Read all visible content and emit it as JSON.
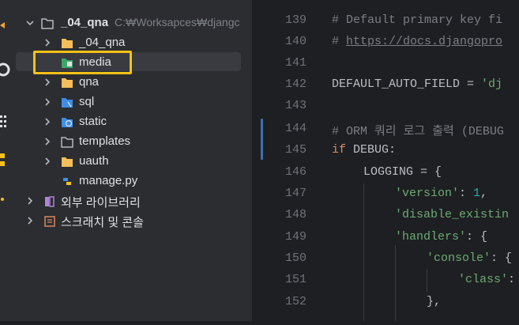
{
  "colors": {
    "highlight": "#f7c118",
    "keyword": "#cf8e6d",
    "string": "#6aab73",
    "number": "#2aacb8",
    "comment": "#7a7e85"
  },
  "tree": {
    "root": {
      "name": "_04_qna",
      "path": "C:₩Worksapces₩djangc",
      "icon": "folder-icon"
    },
    "items": [
      {
        "label": "_04_qna",
        "icon": "folder-icon"
      },
      {
        "label": "media",
        "icon": "resource-folder-icon"
      },
      {
        "label": "qna",
        "icon": "folder-icon"
      },
      {
        "label": "sql",
        "icon": "sql-folder-icon"
      },
      {
        "label": "static",
        "icon": "web-folder-icon"
      },
      {
        "label": "templates",
        "icon": "folder-outline-icon"
      },
      {
        "label": "uauth",
        "icon": "folder-icon"
      },
      {
        "label": "manage.py",
        "icon": "python-file-icon"
      }
    ],
    "external_libraries": "외부 라이브러리",
    "scratches": "스크래치 및 콘솔"
  },
  "editor": {
    "line_numbers": [
      "139",
      "140",
      "141",
      "142",
      "143",
      "144",
      "145",
      "146",
      "147",
      "148",
      "149",
      "150",
      "151",
      "152"
    ],
    "lines": {
      "l139": "# Default primary key fi",
      "l140_hash": "# ",
      "l140_link": "https://docs.djangopro",
      "l142_a": "DEFAULT_AUTO_FIELD = ",
      "l142_b": "'dj",
      "l144": "# ORM 쿼리 로그 출력 (DEBUG",
      "l145_kw": "if ",
      "l145_rest": "DEBUG:",
      "l146_a": "LOGGING = {",
      "l147_s": "'version'",
      "l147_c": ": ",
      "l147_n": "1",
      "l147_e": ",",
      "l148_s": "'disable_existin",
      "l149_s": "'handlers'",
      "l149_r": ": {",
      "l150_s": "'console'",
      "l150_r": ": {",
      "l151_s": "'class'",
      "l151_r": ":",
      "l152": "},"
    }
  }
}
